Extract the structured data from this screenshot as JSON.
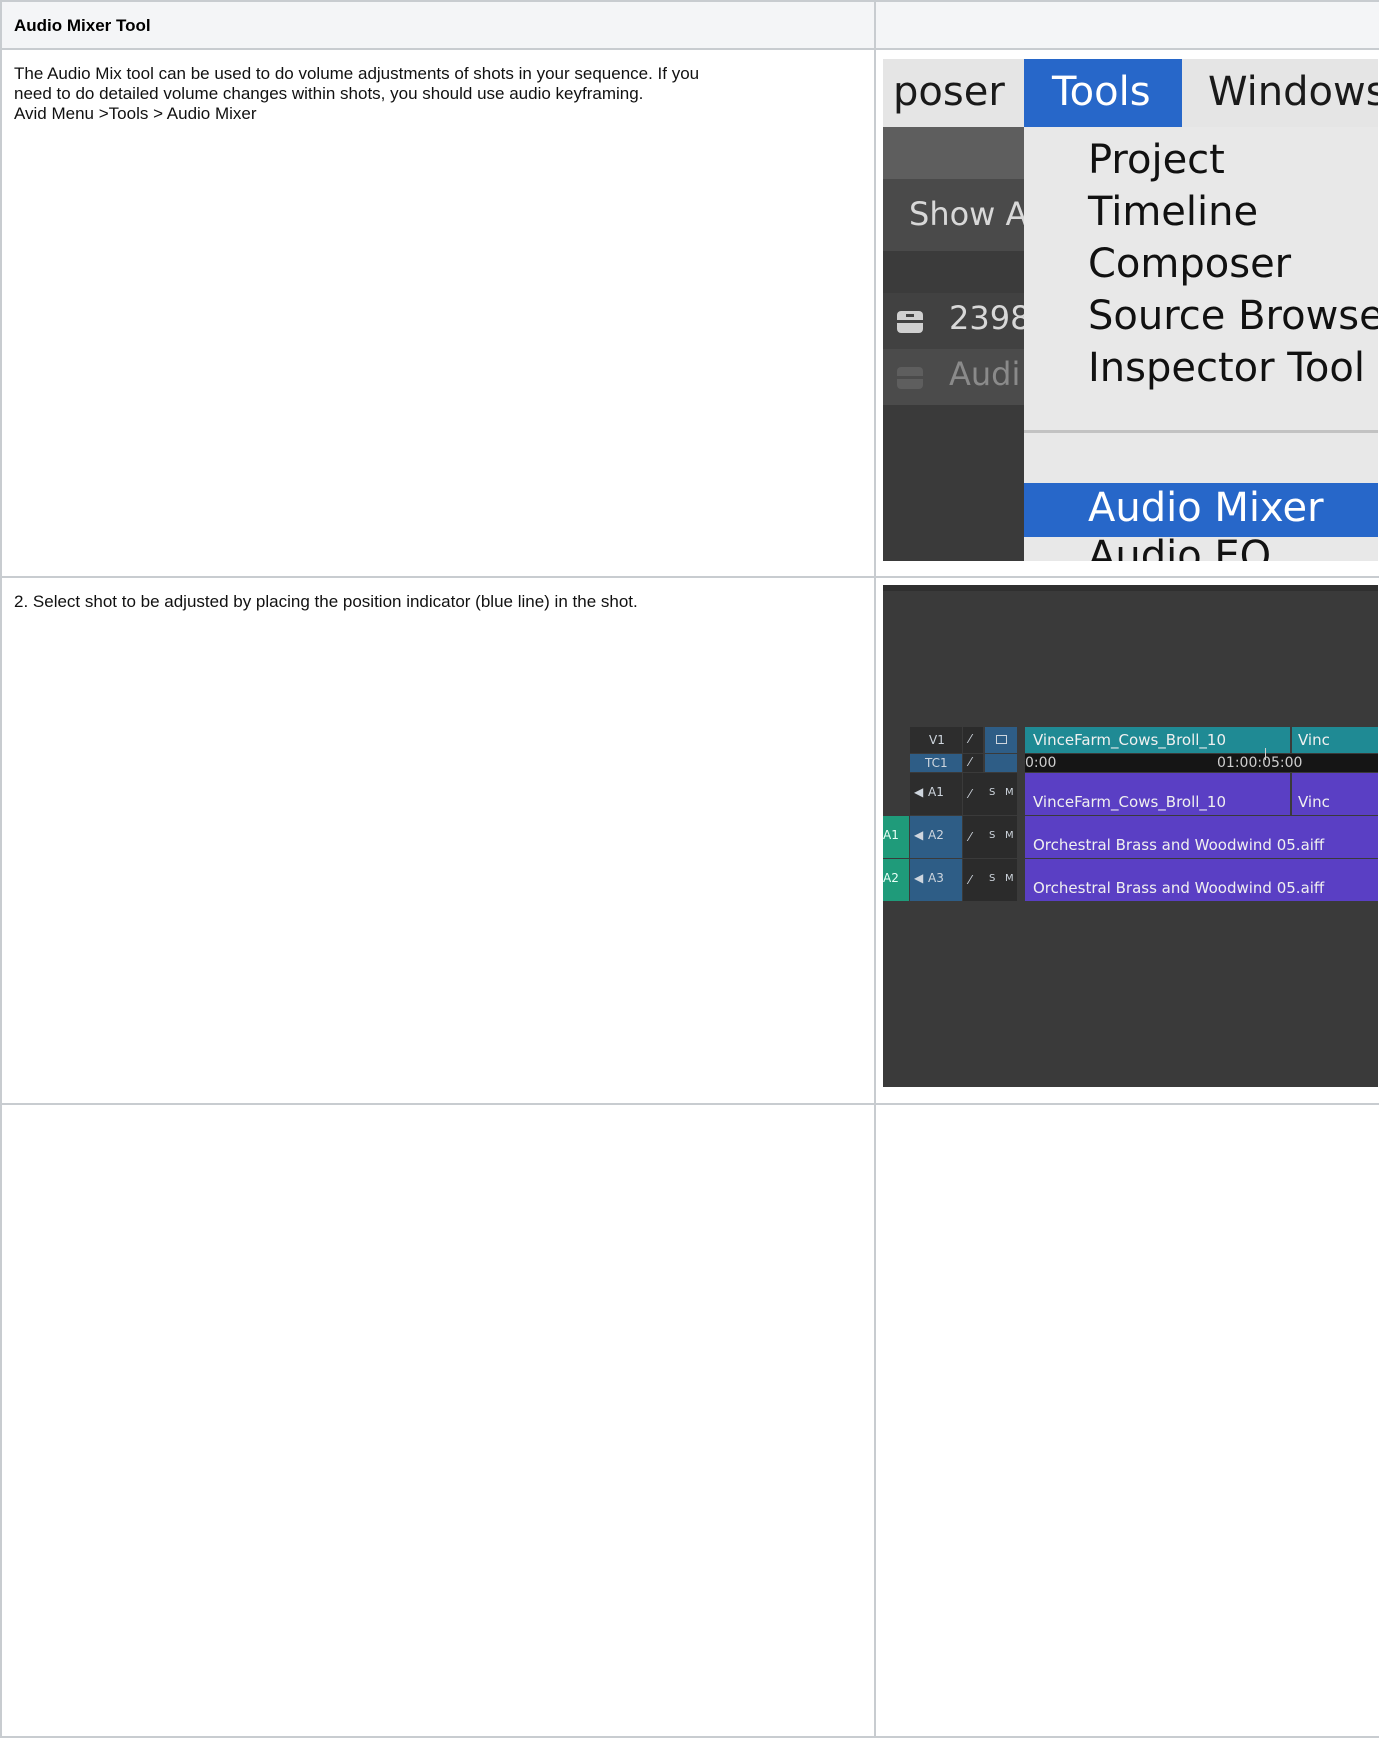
{
  "header": {
    "title": "Audio Mixer Tool"
  },
  "step1": {
    "line1": "The Audio Mix tool can be used to do volume adjustments of shots in your sequence. If you",
    "line2": "need to do detailed volume changes within shots, you should use audio keyframing.",
    "line3": "Avid Menu >Tools > Audio Mixer"
  },
  "step2": {
    "text": "2. Select shot to be adjusted by placing the position indicator (blue line) in the shot."
  },
  "menu_shot": {
    "menubar": {
      "left": "poser",
      "active": "Tools",
      "right": "Windows"
    },
    "side": {
      "show_all": "Show Al",
      "bin1": "2398",
      "bin2": "Audi"
    },
    "items": [
      "Project",
      "Timeline",
      "Composer",
      "Source Browse",
      "Inspector Tool"
    ],
    "highlighted": "Audio Mixer",
    "after": "Audio EQ",
    "colors": {
      "menubar": "#e5e5e5",
      "highlight": "#2767c9",
      "panel": "#3a3a3a"
    }
  },
  "timeline_shot": {
    "tracks": {
      "v1": "V1",
      "tc1": "TC1",
      "a1": "A1",
      "a2": "A2",
      "a3": "A3",
      "src_a1": "A1",
      "src_a2": "A2",
      "solo": "S",
      "mute": "M"
    },
    "timecode": {
      "start": "0:00",
      "mark": "01:00:05:00"
    },
    "clips": {
      "v1": "VinceFarm_Cows_Broll_10",
      "v1_next": "Vinc",
      "a1": "VinceFarm_Cows_Broll_10",
      "a1_next": "Vinc",
      "a2": "Orchestral Brass and Woodwind 05.aiff",
      "a3": "Orchestral Brass and Woodwind 05.aiff"
    },
    "colors": {
      "video_clip": "#1f8a94",
      "audio_clip": "#5a3fc4",
      "track_header": "#2e5d86",
      "source_track": "#1f9b7a"
    }
  }
}
